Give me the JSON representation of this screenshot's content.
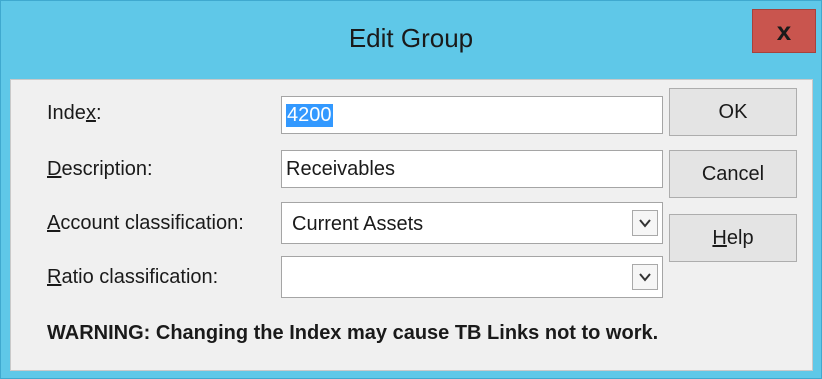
{
  "window": {
    "title": "Edit Group",
    "close_label": "x"
  },
  "form": {
    "index": {
      "label_pre": "Inde",
      "label_key": "x",
      "label_post": ":",
      "value": "4200"
    },
    "description": {
      "label_key": "D",
      "label_post": "escription:",
      "value": "Receivables"
    },
    "account_classification": {
      "label_key": "A",
      "label_post": "ccount classification:",
      "value": "Current Assets"
    },
    "ratio_classification": {
      "label_key": "R",
      "label_post": "atio classification:",
      "value": ""
    }
  },
  "buttons": {
    "ok": "OK",
    "cancel": "Cancel",
    "help_key": "H",
    "help_post": "elp"
  },
  "warning": "WARNING:  Changing the Index may cause TB Links not to work."
}
